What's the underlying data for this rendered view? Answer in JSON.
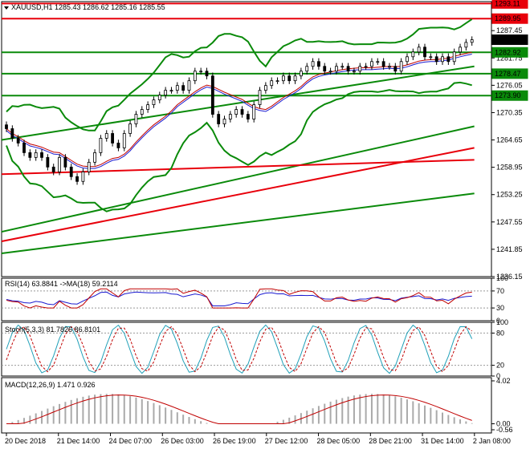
{
  "chart_data": {
    "type": "candlestick",
    "symbol_header": "XAUUSD,H1 1285.43 1286.62 1285.16 1285.55",
    "price_axis": {
      "ticks": [
        "1287.45",
        "1281.75",
        "1276.05",
        "1270.35",
        "1264.65",
        "1258.95",
        "1253.25",
        "1247.55",
        "1241.85",
        "1236.15"
      ],
      "range": [
        1236.15,
        1293.5
      ]
    },
    "price_tags": [
      {
        "value": "1293.11",
        "color": "#e8000b"
      },
      {
        "value": "1289.95",
        "color": "#e8000b"
      },
      {
        "value": "1285.55",
        "color": "#000000"
      },
      {
        "value": "1282.92",
        "color": "#0a8a0a"
      },
      {
        "value": "1278.47",
        "color": "#0a8a0a"
      },
      {
        "value": "1273.90",
        "color": "#0a8a0a"
      }
    ],
    "horizontal_levels": [
      {
        "value": 1293.11,
        "color": "#e8000b"
      },
      {
        "value": 1289.95,
        "color": "#e8000b"
      },
      {
        "value": 1282.92,
        "color": "#0a8a0a"
      },
      {
        "value": 1278.47,
        "color": "#0a8a0a"
      },
      {
        "value": 1273.9,
        "color": "#0a8a0a"
      }
    ],
    "time_axis": [
      "20 Dec 2018",
      "21 Dec 14:00",
      "24 Dec 07:00",
      "26 Dec 03:00",
      "26 Dec 19:00",
      "27 Dec 12:00",
      "28 Dec 05:00",
      "28 Dec 21:00",
      "31 Dec 14:00",
      "2 Jan 08:00"
    ],
    "candle_closes_approx": [
      1267,
      1265,
      1264,
      1262,
      1261,
      1262,
      1261,
      1259,
      1258,
      1261,
      1259,
      1257,
      1256,
      1258,
      1260,
      1262,
      1265,
      1266,
      1264,
      1263,
      1266,
      1268,
      1270,
      1271,
      1272,
      1273,
      1274,
      1275,
      1275,
      1276,
      1275,
      1277,
      1279,
      1279,
      1278,
      1270,
      1268,
      1269,
      1270,
      1271,
      1270,
      1269,
      1272,
      1275,
      1276,
      1277,
      1277,
      1278,
      1277,
      1278,
      1279,
      1280,
      1281,
      1280,
      1279,
      1279,
      1280,
      1280,
      1279,
      1279,
      1280,
      1280,
      1281,
      1281,
      1280,
      1280,
      1279,
      1281,
      1282,
      1283,
      1284,
      1282,
      1282,
      1281,
      1282,
      1281,
      1283,
      1284,
      1285,
      1285.55
    ],
    "trend_lines": [
      {
        "color": "#0a8a0a",
        "from": [
          1264.65,
          0
        ],
        "to": [
          1280.0,
          1
        ]
      },
      {
        "color": "#0a8a0a",
        "from": [
          1245.5,
          0
        ],
        "to": [
          1267.5,
          1
        ]
      },
      {
        "color": "#e8000b",
        "from": [
          1243.5,
          0
        ],
        "to": [
          1263.0,
          1
        ]
      },
      {
        "color": "#e8000b",
        "from": [
          1257.5,
          0
        ],
        "to": [
          1260.5,
          1
        ]
      },
      {
        "color": "#0a8a0a",
        "from": [
          1241.0,
          0
        ],
        "to": [
          1253.5,
          1
        ]
      }
    ],
    "rsi": {
      "label": "RSI(14) 63.8841 ->MA(18) 59.2114",
      "ticks": [
        "100",
        "70",
        "30",
        "0"
      ]
    },
    "stoch": {
      "label": "Stoch(5,3,3) 81.7826 86.8101",
      "ticks": [
        "100",
        "80",
        "20",
        "0"
      ]
    },
    "macd": {
      "label": "MACD(12,26,9) 1.471 0.926",
      "ticks": [
        "4.02",
        "0.00",
        "-0.56"
      ]
    }
  }
}
